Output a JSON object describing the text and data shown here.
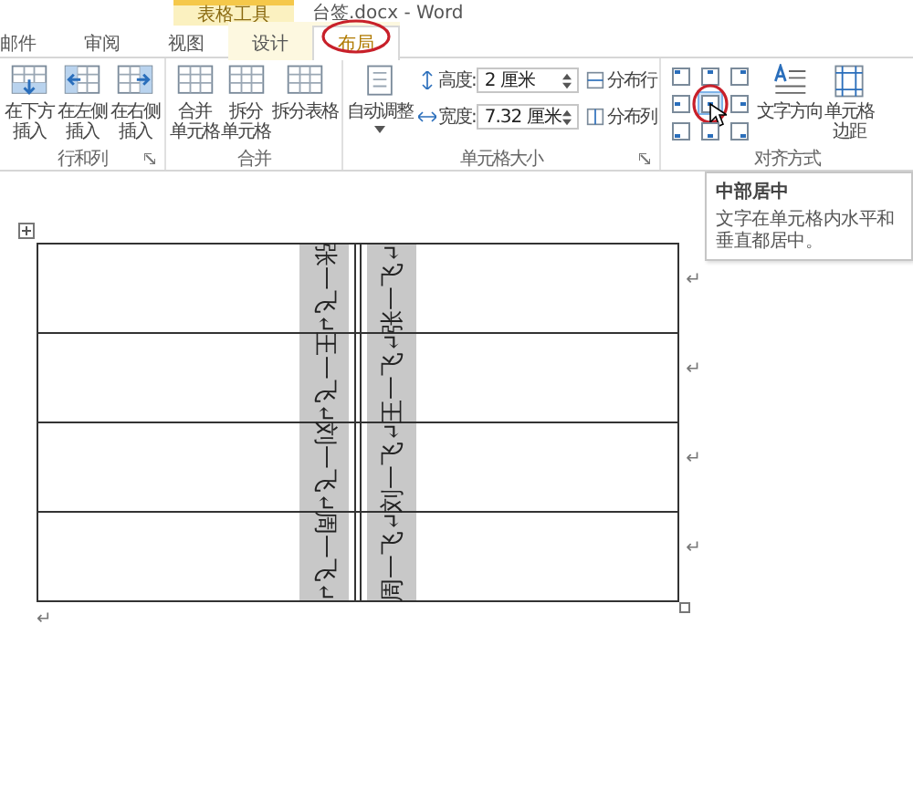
{
  "title_bar": {
    "context_label": "表格工具",
    "title": "台签.docx - Word"
  },
  "tabs": [
    {
      "label": "邮件",
      "selected": false,
      "circled": false
    },
    {
      "label": "审阅",
      "selected": false,
      "circled": false
    },
    {
      "label": "视图",
      "selected": false,
      "circled": false
    },
    {
      "label": "设计",
      "selected": false,
      "circled": false
    },
    {
      "label": "布局",
      "selected": true,
      "circled": true
    }
  ],
  "ribbon": {
    "groups": [
      {
        "kind": "large_buttons",
        "label": "行和列",
        "launcher": true,
        "buttons": [
          {
            "lines": [
              "在下方插入"
            ]
          },
          {
            "lines": [
              "在左侧插入"
            ]
          },
          {
            "lines": [
              "在右侧插入"
            ]
          }
        ]
      },
      {
        "kind": "large_buttons",
        "label": "合并",
        "launcher": false,
        "buttons": [
          {
            "lines": [
              "合并",
              "单元格"
            ]
          },
          {
            "lines": [
              "拆分",
              "单元格"
            ]
          },
          {
            "lines": [
              "拆分表格"
            ]
          }
        ]
      },
      {
        "kind": "cell_size",
        "label": "单元格大小",
        "launcher": true,
        "autofit": "自动调整",
        "fields": [
          {
            "label": "高度:",
            "value": "2 厘米"
          },
          {
            "label": "宽度:",
            "value": "7.32 厘米"
          }
        ],
        "distribute": [
          "分布行",
          "分布列"
        ]
      },
      {
        "kind": "alignment",
        "label": "对齐方式",
        "launcher": false,
        "cells": [
          {
            "selected": false,
            "circled": false
          },
          {
            "selected": false,
            "circled": false
          },
          {
            "selected": false,
            "circled": false
          },
          {
            "selected": false,
            "circled": false
          },
          {
            "selected": true,
            "circled": true
          },
          {
            "selected": false,
            "circled": false
          },
          {
            "selected": false,
            "circled": false
          },
          {
            "selected": false,
            "circled": false
          },
          {
            "selected": false,
            "circled": false
          }
        ],
        "buttons": [
          {
            "lines": [
              "文字方向"
            ]
          },
          {
            "lines": [
              "单元格",
              "边距"
            ]
          }
        ]
      }
    ]
  },
  "tooltip": {
    "title": "中部居中",
    "text": "文字在单元格内水平和垂直都居中。"
  },
  "table": {
    "rows": [
      {
        "left": "张一飞↵",
        "right": "张一飞↵",
        "end_mark": "↵"
      },
      {
        "left": "王一飞↵",
        "right": "王一飞↵",
        "end_mark": "↵"
      },
      {
        "left": "刘一飞↵",
        "right": "刘一飞↵",
        "end_mark": "↵"
      },
      {
        "left": "周一飞↵",
        "right": "周一飞↵",
        "end_mark": "↵"
      }
    ]
  },
  "paragraph_mark": "↵"
}
